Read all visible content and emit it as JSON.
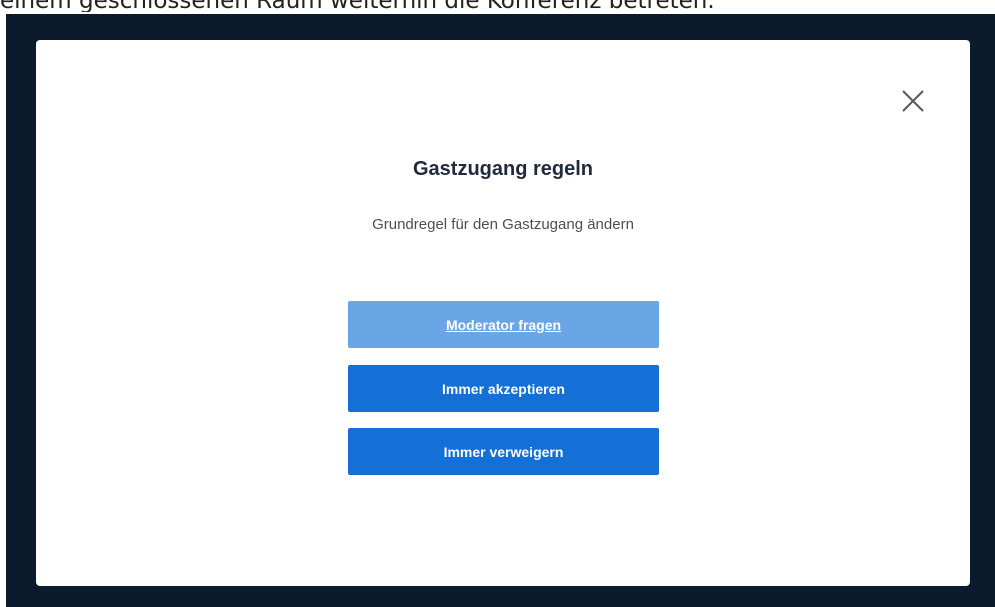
{
  "caption": "einem geschlossenen Raum weiterhin die Konferenz betreten.",
  "modal": {
    "close_icon": "close-icon",
    "title": "Gastzugang regeln",
    "subtitle": "Grundregel für den Gastzugang ändern",
    "buttons": {
      "moderator": "Moderator fragen",
      "accept": "Immer akzeptieren",
      "deny": "Immer verweigern"
    }
  },
  "colors": {
    "backdrop": "#0b1a2c",
    "primary_button": "#1470d6",
    "selected_button": "#6aa6e6"
  }
}
